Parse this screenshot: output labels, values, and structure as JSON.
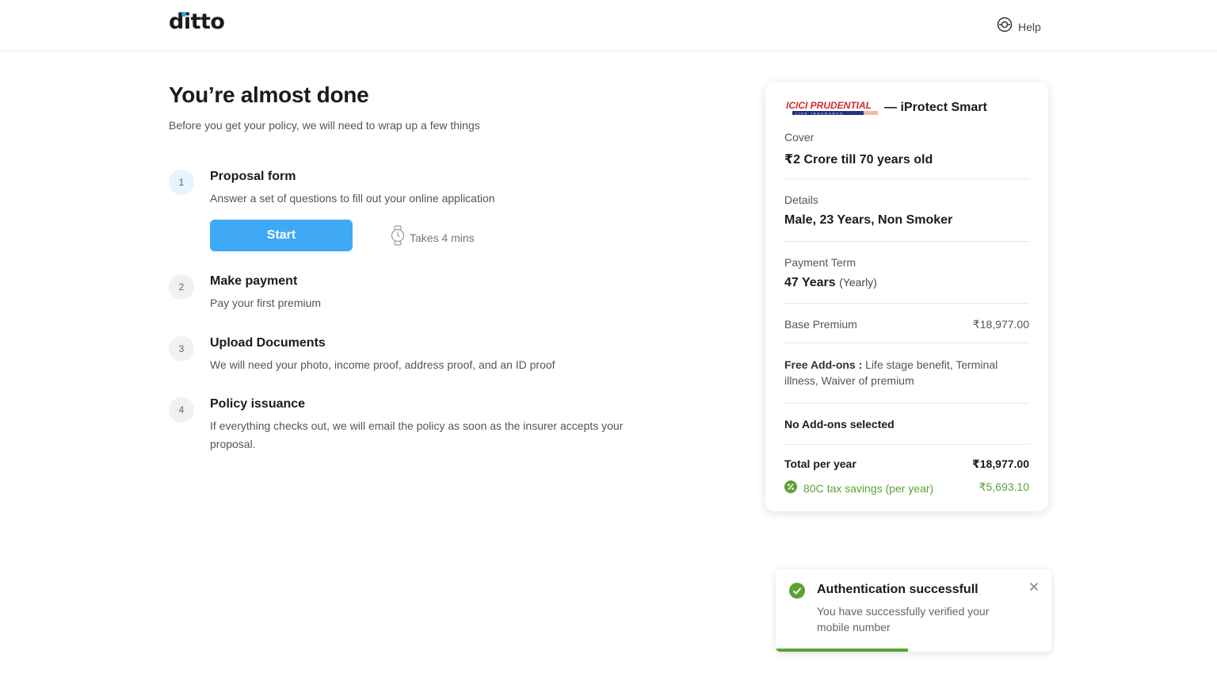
{
  "header": {
    "logo_text": "ditto",
    "help_label": "Help",
    "help_icon": "help-lifebuoy-icon"
  },
  "main": {
    "title": "You’re almost done",
    "subtitle": "Before you get your policy, we will need to wrap up a few things",
    "steps": [
      {
        "num": "1",
        "title": "Proposal form",
        "desc": "Answer a set of questions to fill out your online application"
      },
      {
        "num": "2",
        "title": "Make payment",
        "desc": "Pay your first premium"
      },
      {
        "num": "3",
        "title": "Upload Documents",
        "desc": "We will need your photo, income proof, address proof, and an ID proof"
      },
      {
        "num": "4",
        "title": "Policy issuance",
        "desc": "If everything checks out, we will email the policy as soon as the insurer accepts your proposal."
      }
    ],
    "start_label": "Start",
    "takes_label": "Takes 4 mins",
    "takes_icon": "watch-icon"
  },
  "summary": {
    "insurer_logo_text": "ICICI PRUDENTIAL",
    "insurer_logo_subtext": "LIFE INSURANCE",
    "plan": "— iProtect Smart",
    "cover_label": "Cover",
    "cover_value": "₹2 Crore till 70 years old",
    "details_label": "Details",
    "details_value": "Male, 23 Years, Non Smoker",
    "payment_term_label": "Payment Term",
    "payment_term_value": "47 Years",
    "payment_term_freq": "(Yearly)",
    "base_premium_label": "Base Premium",
    "base_premium_value": "₹18,977.00",
    "free_addons_label": "Free Add-ons :",
    "free_addons_value": " Life stage benefit, Terminal illness, Waiver of premium",
    "no_addons": "No Add-ons selected",
    "total_label": "Total per year",
    "total_value": "₹18,977.00",
    "tax_label": "80C tax savings (per year)",
    "tax_value": "₹5,693.10",
    "tax_icon": "percent-icon"
  },
  "toast": {
    "title": "Authentication successfull",
    "message": "You have successfully verified your mobile number",
    "progress": 0.48,
    "icon": "check-circle-icon",
    "close_icon": "close-icon"
  },
  "colors": {
    "primary": "#3fa9f5",
    "success": "#5aa233",
    "brand_dot": "#27a8e8",
    "insurer_red": "#d62a2a",
    "insurer_blue": "#24327e"
  }
}
